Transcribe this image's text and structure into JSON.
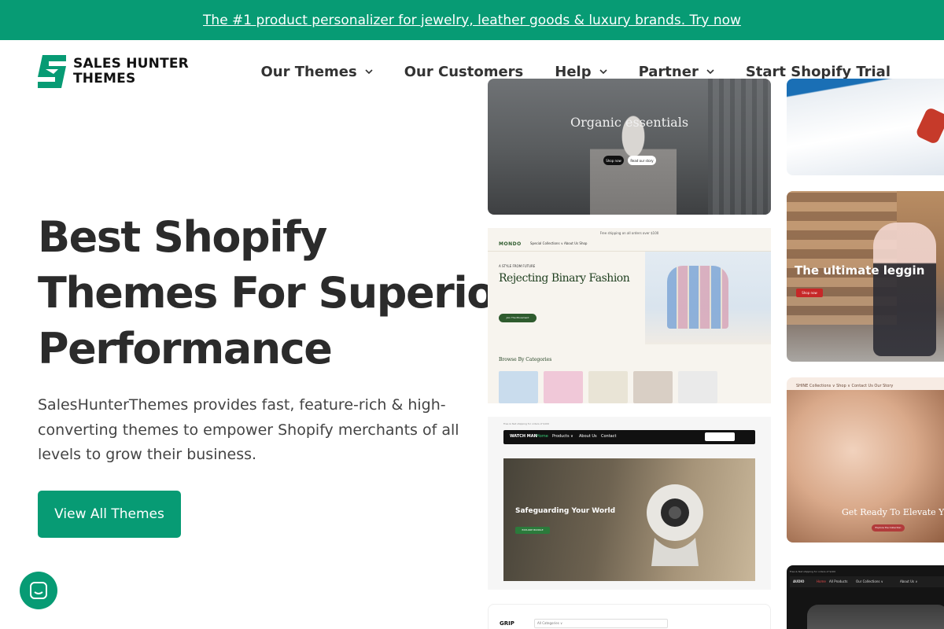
{
  "promo": {
    "text": "The #1 product personalizer for jewelry, leather goods & luxury brands. Try now"
  },
  "logo": {
    "line1": "SALES HUNTER",
    "line2": "THEMES"
  },
  "nav": {
    "items": [
      {
        "label": "Our Themes",
        "has_dropdown": true
      },
      {
        "label": "Our Customers",
        "has_dropdown": false
      },
      {
        "label": "Help",
        "has_dropdown": true
      },
      {
        "label": "Partner",
        "has_dropdown": true
      },
      {
        "label": "Start Shopify Trial",
        "has_dropdown": false
      }
    ]
  },
  "hero": {
    "title_highlight": "Best Shopify",
    "title_line2": "Themes For Superior",
    "title_line3": "Performance",
    "subtitle": "SalesHunterThemes provides fast, feature-rich & high-converting themes to empower Shopify merchants of all levels to grow their business.",
    "cta": "View All Themes"
  },
  "previews": {
    "organic": {
      "title": "Organic essentials",
      "btn1": "Shop now",
      "btn2": "Read our story"
    },
    "mondo": {
      "announcement": "Free shipping on all orders over $100",
      "logo": "MONDO",
      "menu": "Special Collections ∨   About Us   Shop",
      "eyebrow": "A STYLE FROM FUTURE",
      "title": "Rejecting Binary Fashion",
      "button": "Join The Movement",
      "categories": "Browse By Categories"
    },
    "watchman": {
      "topbar": "Free & fast shipping for orders of $100",
      "logo": "WATCH MAN",
      "nav": [
        "Home",
        "Products ∨",
        "About Us",
        "Contact"
      ],
      "title": "Safeguarding Your World",
      "button": "EXPLORE BUNDLE"
    },
    "grip": {
      "logo": "GRIP",
      "search": "All Categories ∨"
    },
    "leggings": {
      "title": "The ultimate leggin",
      "button": "Shop now"
    },
    "shine": {
      "header": "SHINE   Collections ∨   Shop ∨   Contact Us   Our Story",
      "title": "Get Ready To Elevate Yo",
      "button": "Explore the Collection"
    },
    "audio": {
      "topbar": "Free & fast shipping for orders of $100",
      "nav": [
        "AUDIO",
        "Home",
        "All Products",
        "Our Collections ∨",
        "About Us ∨"
      ]
    }
  },
  "colors": {
    "brand": "#079b74",
    "highlight": "#f2c94c",
    "text": "#2b2b2b"
  },
  "icons": {
    "chat": "chat-bubble-icon",
    "dropdown": "chevron-down-icon"
  }
}
